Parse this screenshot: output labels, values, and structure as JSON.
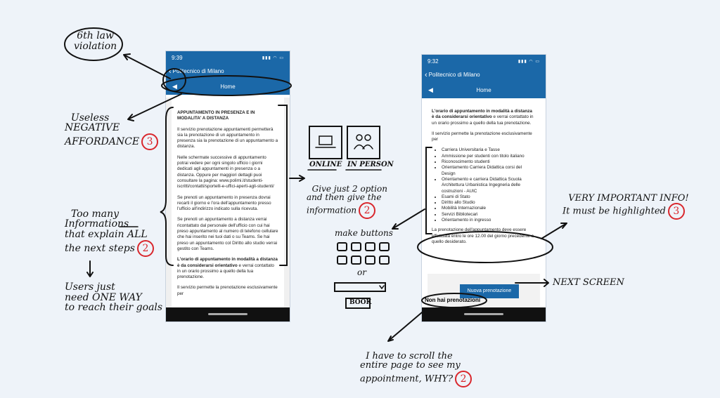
{
  "phone_left": {
    "time": "9:39",
    "back_label": "Politecnico di Milano",
    "title": "Home",
    "heading": "APPUNTAMENTO IN PRESENZA E IN MODALITA' A DISTANZA",
    "p1": "Il servizio prenotazione appuntamenti permetterà sia la prenotazione di un appuntamento in presenza sia la prenotazione di un appuntamento a distanza.",
    "p2": "Nelle schermate successive di appuntamento potrai vedere per ogni singolo ufficio i giorni dedicati agli appuntamenti in presenza o a distanza. Oppure per maggiori dettagli puoi consultare la pagina: www.polimi.it/studenti-iscritti/contatti/sportelli-e-uffici-aperti-agli-studenti/",
    "p3": "Se prenoti un appuntamento in presenza dovrai recarti il giorno e l'ora dell'appuntamento presso l'ufficio all'indirizzo indicato sulla ricevuta.",
    "p4": "Se prenoti un appuntamento a distanza verrai ricontattato dal personale dell'ufficio con cui hai preso appuntamento al numero di telefono cellulare che hai inserito nei tuoi dati o su Teams. Se hai preso un appuntamento col Diritto allo studio verrai gestito con Teams.",
    "p5_bold": "L'orario di appuntamento in modalità a distanza è da considerarsi orientativo",
    "p5_rest": " e verrai contattato in un orario prossimo a quello della tua prenotazione.",
    "p6": "Il servizio permette la prenotazione esclusivamente per"
  },
  "phone_right": {
    "time": "9:32",
    "back_label": "Politecnico di Milano",
    "title": "Home",
    "p1_bold": "L'orario di appuntamento in modalità a distanza è da considerarsi orientativo",
    "p1_rest": " e verrai contattato in un orario prossimo a quello della tua prenotazione.",
    "p2": "Il servizio permette la prenotazione esclusivamente per",
    "list": [
      "Carriera Universitaria e Tasse",
      "Ammissione per studenti con titolo italiano",
      "Riconoscimento studenti",
      "Orientamento Carriera Didattica corsi del Design",
      "Orientamento e carriera Didattica Scuola Architettura Urbanistica Ingegneria delle costruzioni - AUIC",
      "Esami di Stato",
      "Diritto allo Studio",
      "Mobilità Internazionale",
      "Servizi Bibliotecari",
      "Orientamento in ingresso"
    ],
    "p3": "La prenotazione dell'appuntamento deve essere effettuata entro le ore 12.00 del giorno precedente a quello desiderato.",
    "button": "Nuova prenotazione",
    "no_booking": "Non hai prenotazioni"
  },
  "annotations": {
    "law": "6th law\nviolation",
    "useless": "Useless\nNEGATIVE\nAFFORDANCE",
    "too_many": "Too many\nInformations\nthat explain ALL\nthe next steps",
    "users": "Users just\nneed ONE WAY\nto reach their goals",
    "online": "ONLINE",
    "in_person": "IN PERSON",
    "give": "Give just 2 option\nand then give the\ninformation",
    "make_buttons": "make buttons",
    "or": "or",
    "book": "BOOK",
    "very": "VERY IMPORTANT INFO!\nIt must be highlighted",
    "next": "NEXT SCREEN",
    "scroll": "I have to scroll the\nentire page to see my\nappointment, WHY?",
    "badge_3": "3",
    "badge_2": "2"
  }
}
